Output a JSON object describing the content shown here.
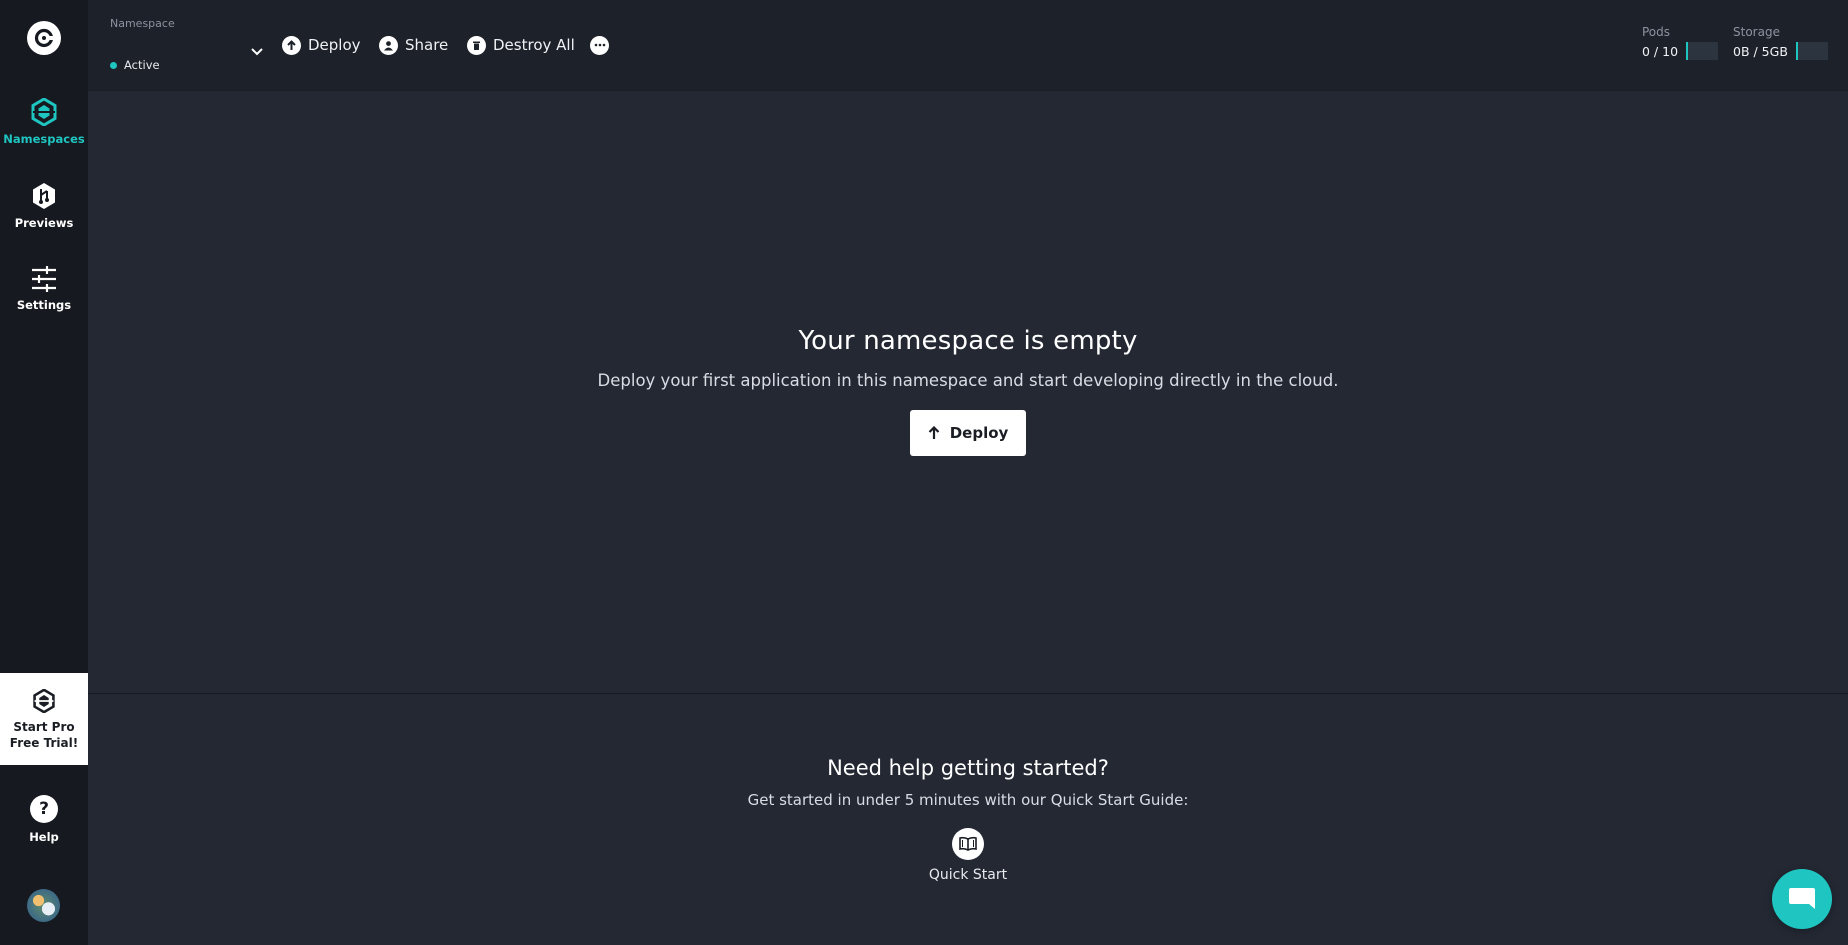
{
  "sidebar": {
    "items": [
      {
        "label": "Namespaces",
        "icon": "namespaces-icon",
        "active": true
      },
      {
        "label": "Previews",
        "icon": "previews-icon",
        "active": false
      },
      {
        "label": "Settings",
        "icon": "settings-icon",
        "active": false
      }
    ],
    "trial": {
      "line1": "Start Pro",
      "line2": "Free Trial!"
    },
    "help": {
      "label": "Help",
      "glyph": "?"
    }
  },
  "topbar": {
    "namespace_label": "Namespace",
    "status": "Active",
    "actions": {
      "deploy": "Deploy",
      "share": "Share",
      "destroy_all": "Destroy All"
    },
    "usage": {
      "pods_label": "Pods",
      "pods_value": "0 / 10",
      "storage_label": "Storage",
      "storage_value": "0B / 5GB"
    }
  },
  "main": {
    "empty_title": "Your namespace is empty",
    "empty_description": "Deploy your first application in this namespace and start developing directly in the cloud.",
    "deploy_button": "Deploy"
  },
  "help_section": {
    "title": "Need help getting started?",
    "description": "Get started in under 5 minutes with our Quick Start Guide:",
    "quick_start": "Quick Start"
  },
  "colors": {
    "accent": "#1fc5c0",
    "background": "#232833",
    "sidebar": "#16191f",
    "topbar": "#1d2129"
  }
}
